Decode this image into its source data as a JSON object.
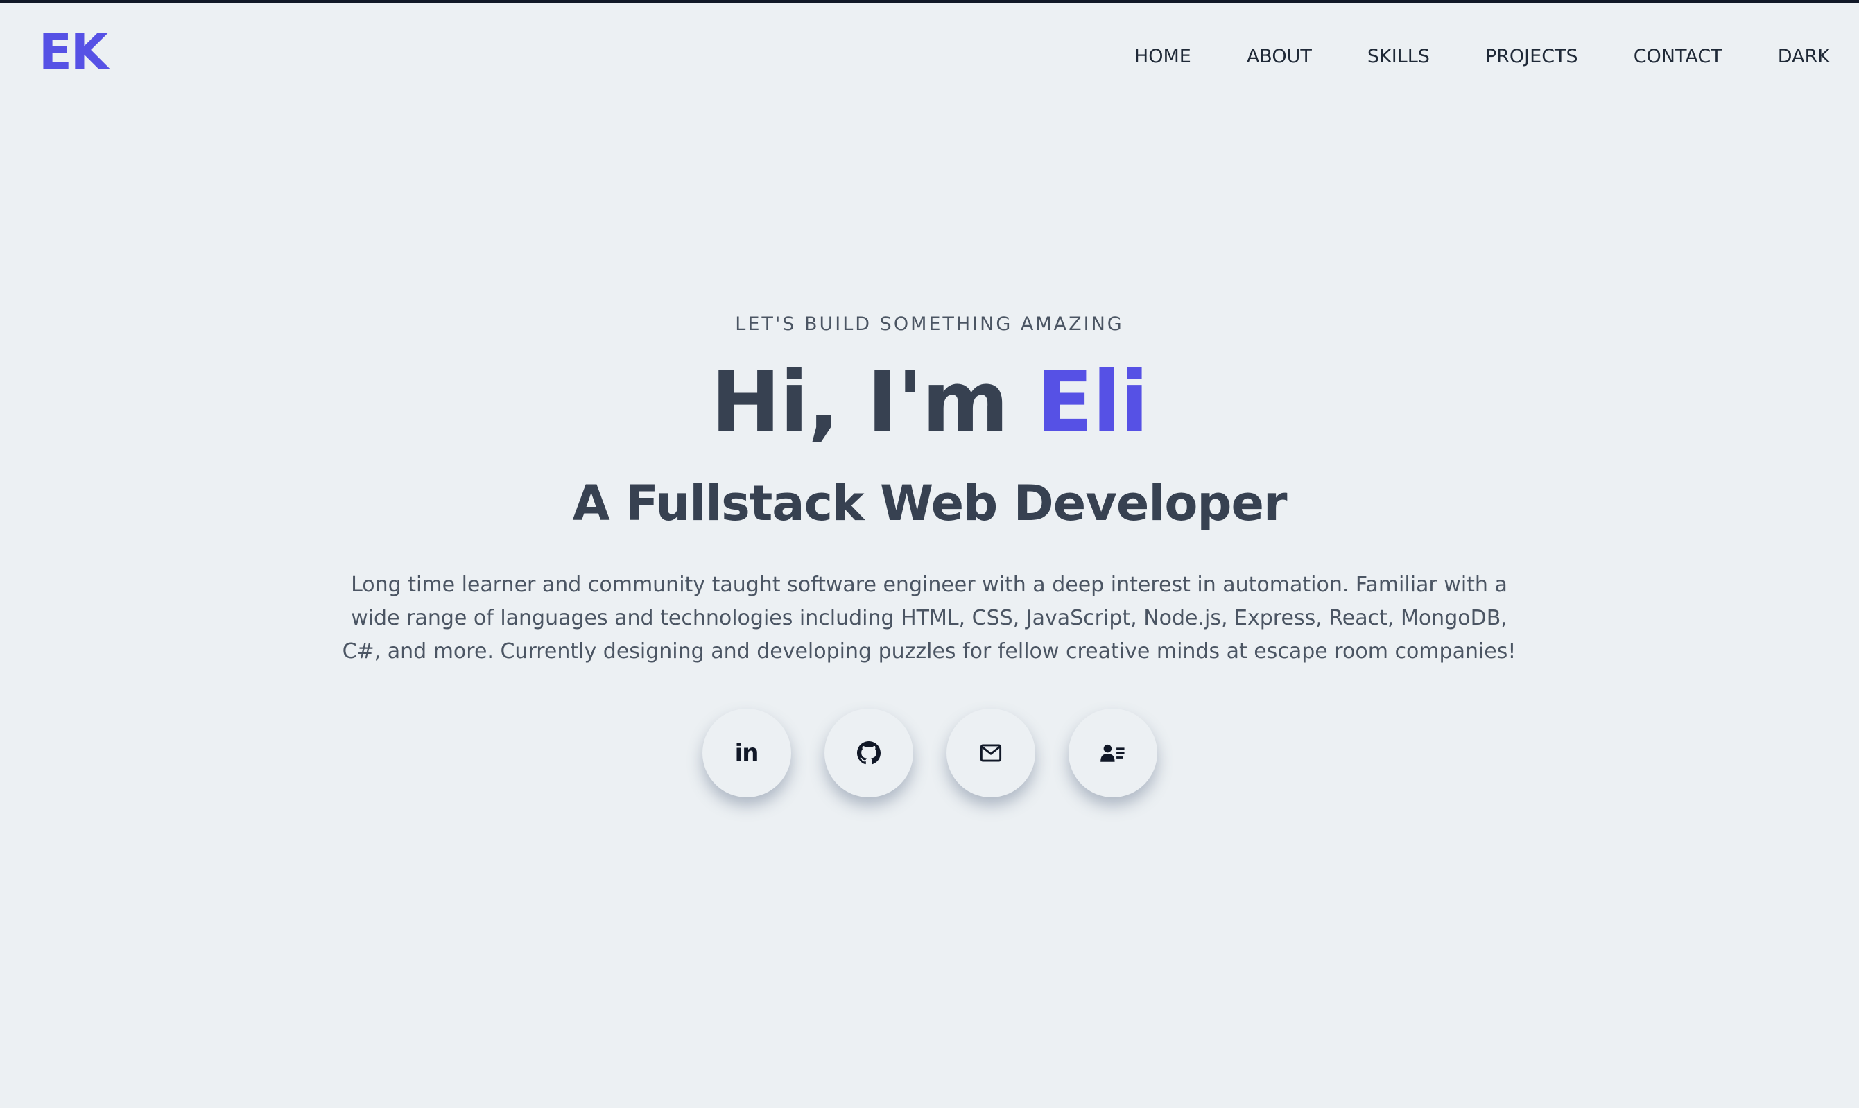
{
  "brand": {
    "logo": "EK",
    "accent_color": "#5651e5"
  },
  "nav": {
    "items": [
      "HOME",
      "ABOUT",
      "SKILLS",
      "PROJECTS",
      "CONTACT",
      "DARK"
    ]
  },
  "hero": {
    "eyebrow": "LET'S BUILD SOMETHING AMAZING",
    "greeting": "Hi, I'm",
    "name": "Eli",
    "subtitle": "A Fullstack Web Developer",
    "bio": "Long time learner and community taught software engineer with a deep interest in automation. Familiar with a wide range of languages and technologies including HTML, CSS, JavaScript, Node.js, Express, React, MongoDB, C#, and more. Currently designing and developing puzzles for fellow creative minds at escape room companies!"
  },
  "socials": [
    {
      "icon": "linkedin-icon",
      "glyph": "in"
    },
    {
      "icon": "github-icon"
    },
    {
      "icon": "mail-icon"
    },
    {
      "icon": "resume-icon"
    }
  ],
  "colors": {
    "background": "#ecf0f3",
    "text": "#374151",
    "accent": "#5651e5"
  }
}
